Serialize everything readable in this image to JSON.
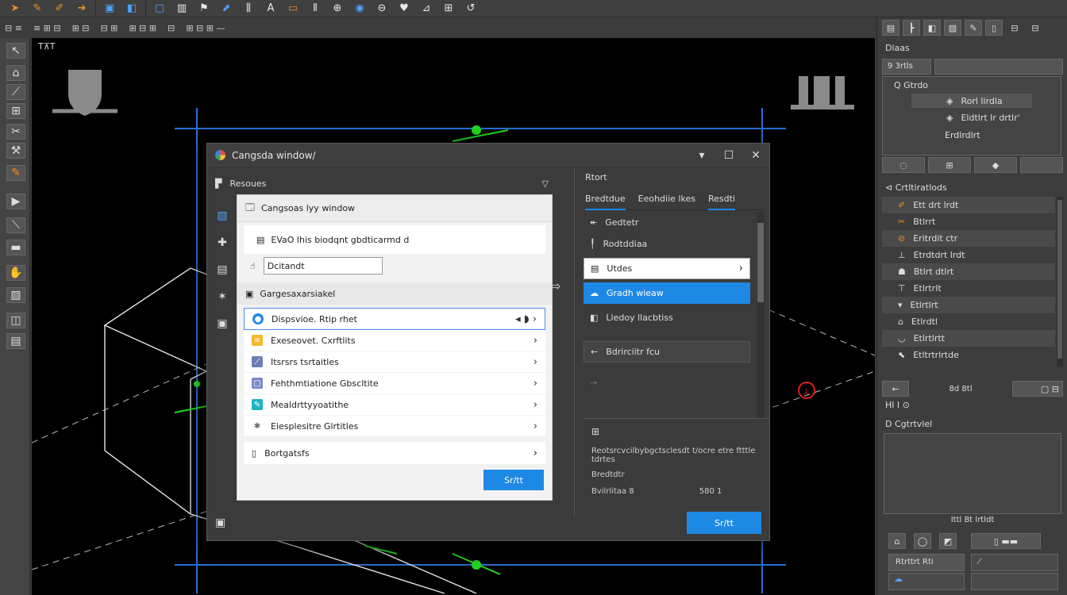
{
  "viewport": {
    "label": "T⊼T"
  },
  "dialog": {
    "title": "Cangsda window/",
    "section_header": "Resoues",
    "panel": {
      "header": "Cangsoas lyy window",
      "row1": "EVaO lhis  biodqnt gbdticarmd d",
      "name_value": "Dcitandt",
      "sub_header": "Gargesaxarsiakel",
      "items": [
        {
          "label": "Dispsvioe.   Rtip rhet",
          "color": "#1e88e5"
        },
        {
          "label": "Exeseovet. Cxrftlits",
          "color": "#f5b82e"
        },
        {
          "label": "Itsrsrs tsrtaitles",
          "color": "#6b7fb6"
        },
        {
          "label": "Fehthmtiatione  Gbscltite",
          "color": "#7a8ac9"
        },
        {
          "label": "Mealdrttyyoatithe",
          "color": "#1fb4c0"
        },
        {
          "label": "Eiesplesitre  Glrtitles",
          "color": "#8a8a8a"
        }
      ],
      "last_item": "Bortgatsfs",
      "panel_button": "Sr/tt"
    },
    "main_button": "Sr/tt",
    "right": {
      "font_label": "Rtort",
      "tabs": [
        "Bredtdue",
        "Eeohdiie lkes",
        "Resdti"
      ],
      "items": [
        "Gedtetr",
        "Rodtddiaa"
      ],
      "box_item": "Utdes",
      "highlighted": "Gradh wieaw",
      "after_hl": "Lledoy llacbtiss",
      "outlined": "Bdrirciitr fcu",
      "bottom_text": "Reotsrcvcilbybgctsclesdt t/ocre  etre ftttle tdrtes",
      "bottom_label": "Bredtdtr",
      "bottom_left": "Bvilrlitaa  8",
      "bottom_right": "580 1"
    }
  },
  "rightpanel": {
    "head": "Dlaas",
    "tabs": [
      "9 3rtls",
      ""
    ],
    "tree_root": "Q Gtrdo",
    "tree_items": [
      "Rorl lirdla",
      "Eldtlrt lr  drtlr'",
      "Erdlrdlrt"
    ],
    "list_title": "Crtltiratlods",
    "list_items": [
      "Ett drt lrdt",
      "Btlrrt",
      "Eritrdit ctr",
      "Etrdtdrt lrdt",
      "Btlrt dtlrt",
      "Etlrtrlt",
      "Etlrtlrt",
      "Etlrdtl",
      "Etlrtlrtt",
      "Etltrtrlrtde"
    ],
    "bottom_head": "8d  8tl",
    "prop_head": "Hl I  ⊙",
    "prop_title": "D Cgtrtvlel",
    "bottom_bar": "Ittl  Bt lrtldt",
    "bottom_field": "Rtrttrt Rti"
  }
}
